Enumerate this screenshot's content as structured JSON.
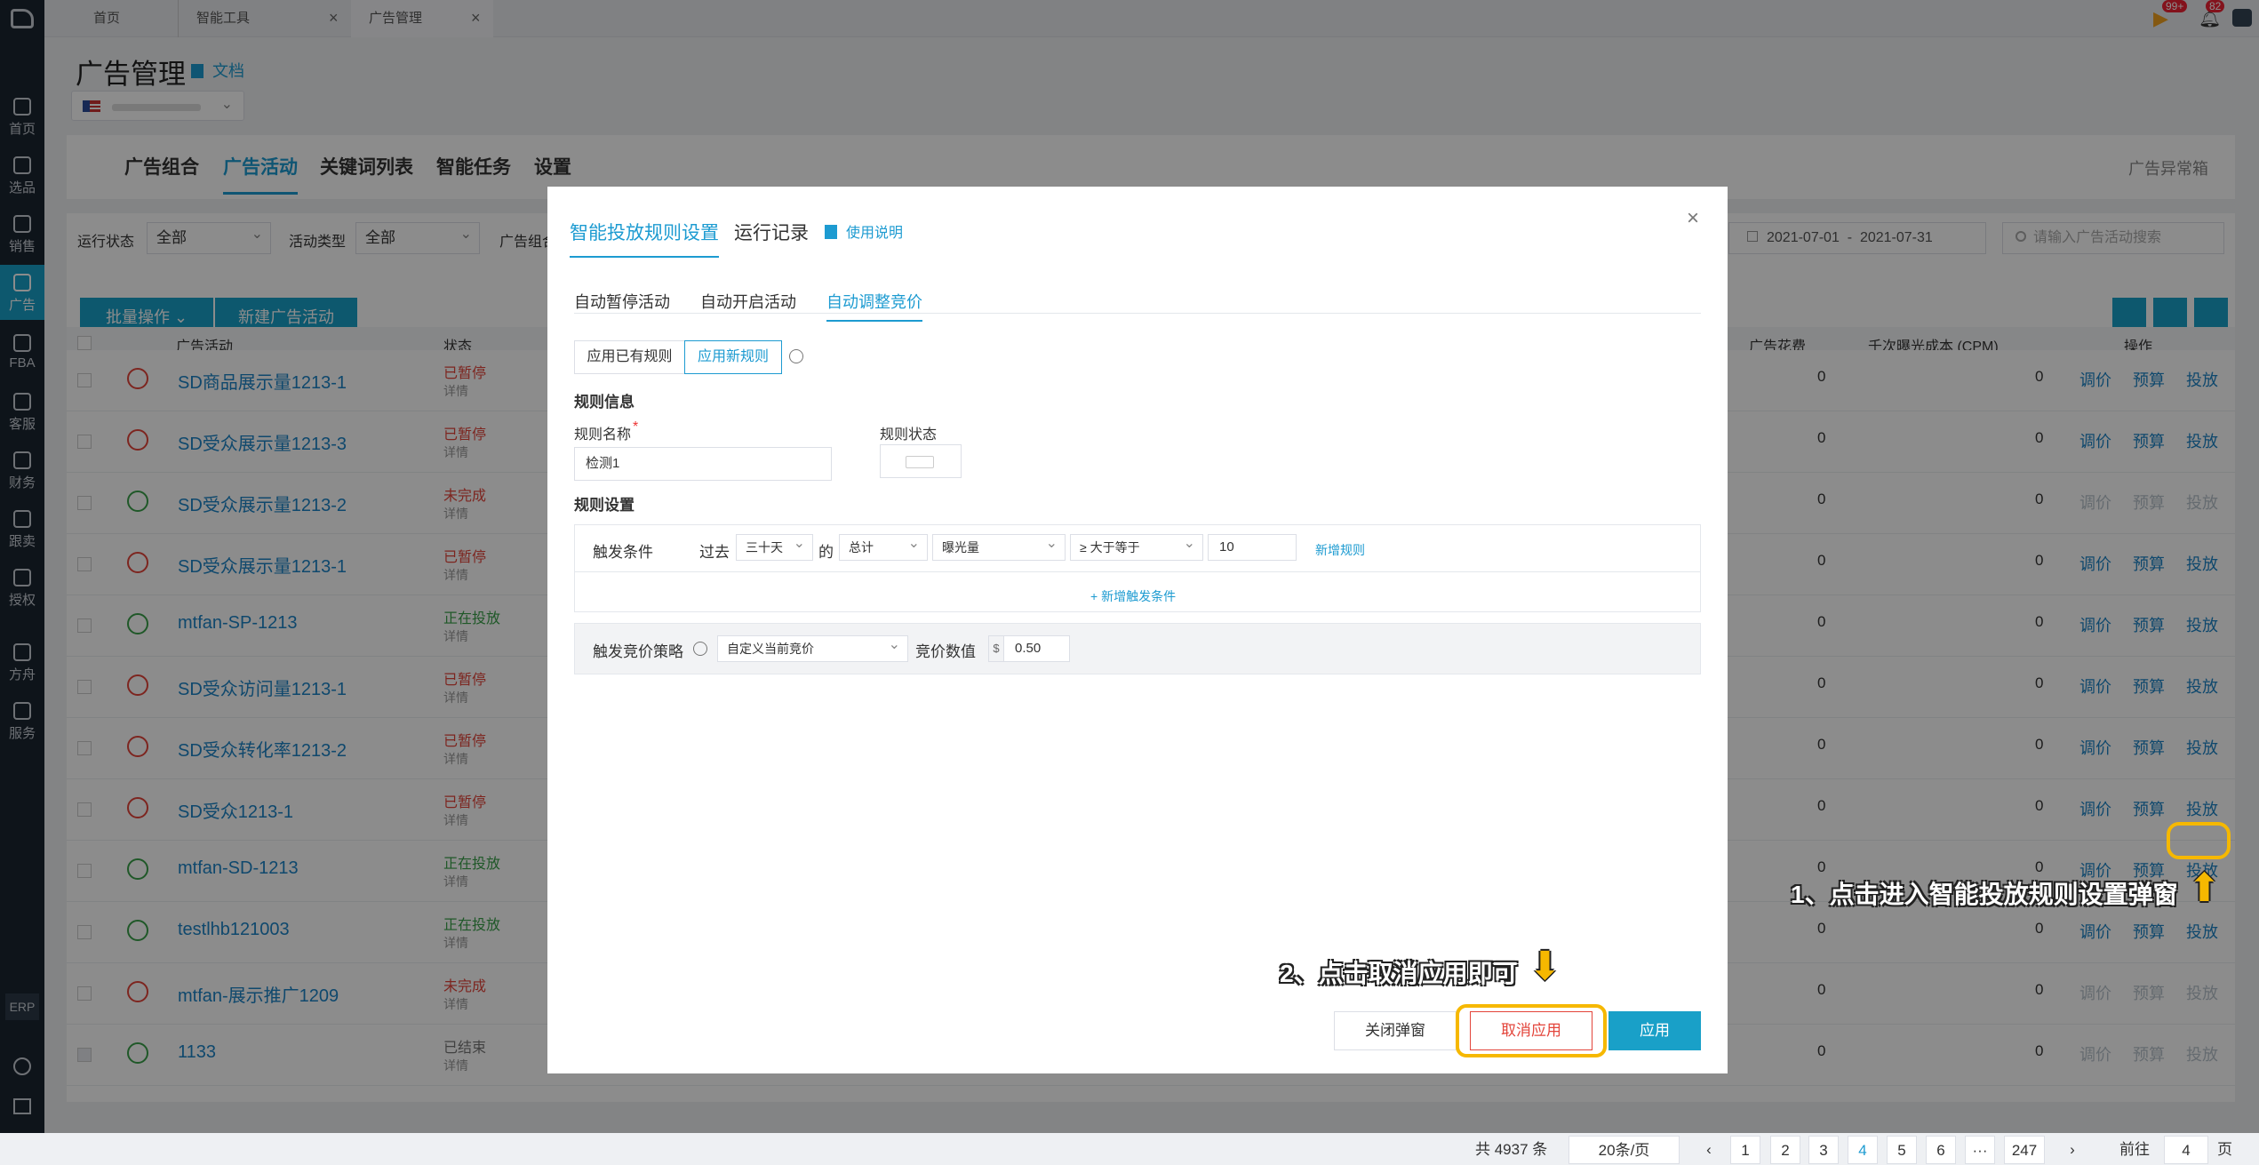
{
  "topbar": {
    "tabs": [
      "首页",
      "智能工具",
      "广告管理"
    ],
    "badge1": "99+",
    "badge2": "82"
  },
  "sidebar": {
    "items": [
      "首页",
      "选品",
      "销售",
      "广告",
      "FBA",
      "客服",
      "财务",
      "跟卖",
      "授权",
      "方舟",
      "服务"
    ],
    "erp": "ERP"
  },
  "page": {
    "title": "广告管理",
    "doc_link": "文档",
    "nav": [
      "广告组合",
      "广告活动",
      "关键词列表",
      "智能任务",
      "设置"
    ],
    "nav_right": "广告异常箱",
    "filters": {
      "run_status_label": "运行状态",
      "run_status": "全部",
      "type_label": "活动类型",
      "type": "全部",
      "group_label": "广告组合",
      "date_start": "2021-07-01",
      "date_sep": "-",
      "date_end": "2021-07-31",
      "search_placeholder": "请输入广告活动搜索"
    },
    "batch": "批量操作",
    "new": "新建广告活动",
    "headers": {
      "name": "广告活动",
      "status": "状态",
      "spend": "广告花费",
      "cpm": "千次曝光成本 (CPM)",
      "ops": "操作"
    },
    "rows": [
      {
        "name": "SD商品展示量1213-1",
        "status": "已暂停",
        "detail": "详情"
      },
      {
        "name": "SD受众展示量1213-3",
        "status": "已暂停",
        "detail": "详情"
      },
      {
        "name": "SD受众展示量1213-2",
        "status": "未完成",
        "detail": "详情"
      },
      {
        "name": "SD受众展示量1213-1",
        "status": "已暂停",
        "detail": "详情"
      },
      {
        "name": "mtfan-SP-1213",
        "status": "正在投放",
        "detail": "详情"
      },
      {
        "name": "SD受众访问量1213-1",
        "status": "已暂停",
        "detail": "详情"
      },
      {
        "name": "SD受众转化率1213-2",
        "status": "已暂停",
        "detail": "详情"
      },
      {
        "name": "SD受众1213-1",
        "status": "已暂停",
        "detail": "详情"
      },
      {
        "name": "mtfan-SD-1213",
        "status": "正在投放",
        "detail": "详情"
      },
      {
        "name": "testlhb121003",
        "status": "正在投放",
        "detail": "详情"
      },
      {
        "name": "mtfan-展示推广1209",
        "status": "未完成",
        "detail": "详情"
      },
      {
        "name": "1133",
        "status": "已结束",
        "detail": "详情"
      }
    ],
    "zero": "0",
    "ops": [
      "调价",
      "预算",
      "投放"
    ],
    "pagination": {
      "total": "共 4937 条",
      "size": "20条/页",
      "pages": [
        "1",
        "2",
        "3",
        "4",
        "5",
        "6",
        "···",
        "247"
      ],
      "goto": "前往",
      "goto_val": "4",
      "page_suffix": "页"
    }
  },
  "modal": {
    "tabs": [
      "智能投放规则设置",
      "运行记录",
      "使用说明"
    ],
    "subtabs": [
      "自动暂停活动",
      "自动开启活动",
      "自动调整竞价"
    ],
    "rule_btns": [
      "应用已有规则",
      "应用新规则"
    ],
    "rule_info": "规则信息",
    "rule_name_label": "规则名称",
    "rule_name": "检测1",
    "rule_status_label": "规则状态",
    "rule_setting": "规则设置",
    "trigger_label": "触发条件",
    "past": "过去",
    "period": "三十天",
    "of": "的",
    "agg": "总计",
    "metric": "曝光量",
    "cmp": "≥ 大于等于",
    "value": "10",
    "add_rule": "新增规则",
    "add_condition": "+ 新增触发条件",
    "strategy_label": "触发竞价策略",
    "strategy": "自定义当前竞价",
    "bid_label": "竞价数值",
    "currency": "$",
    "bid": "0.50",
    "close": "关闭弹窗",
    "cancel": "取消应用",
    "apply": "应用"
  },
  "annotations": {
    "step1": "1、点击进入智能投放规则设置弹窗",
    "step2": "2、点击取消应用即可"
  }
}
